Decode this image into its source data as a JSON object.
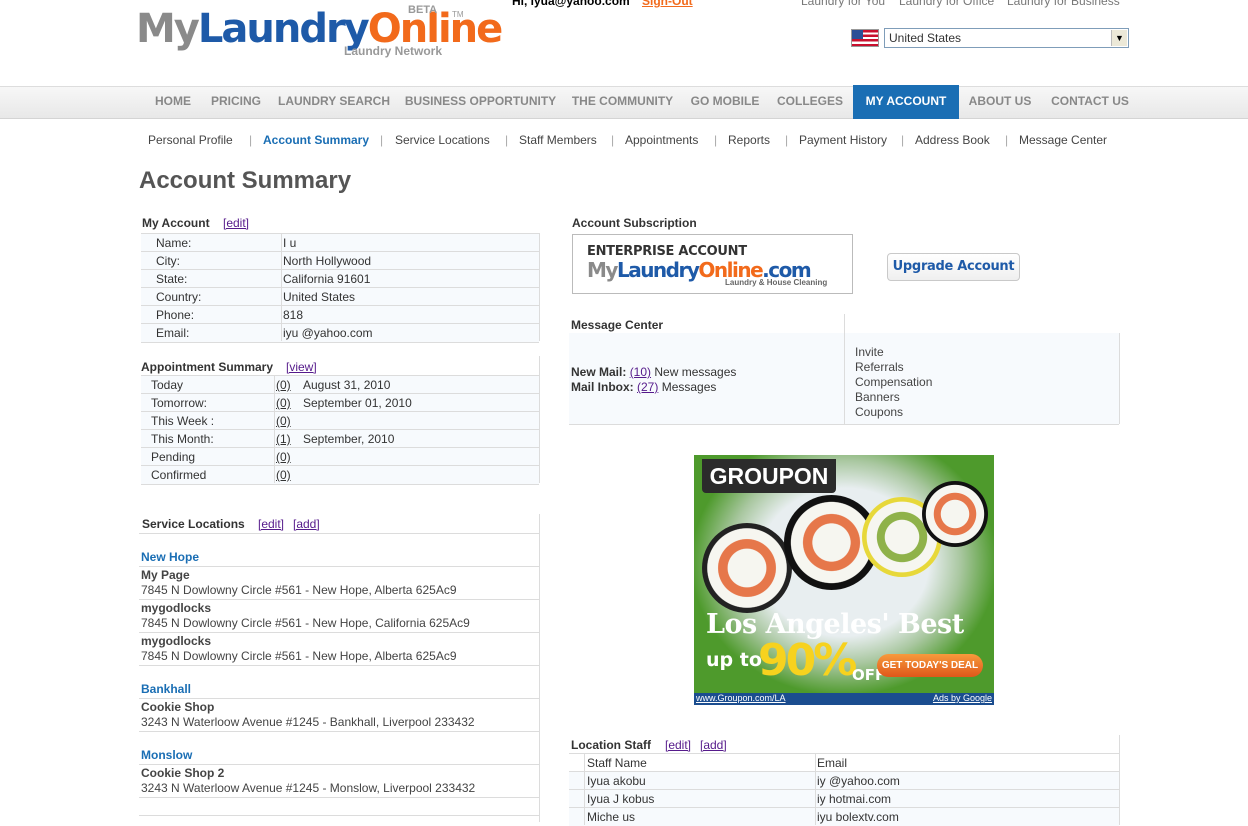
{
  "header": {
    "logo": {
      "my": "My",
      "laundry": "Laundry",
      "online": "Online",
      "beta": "BETA",
      "tm": "TM",
      "tagline": "Laundry Network"
    },
    "greeting": "Hi, iyua@yahoo.com",
    "sign_out": "Sign-Out",
    "top_links": [
      "Laundry for You",
      "Laundry for Office",
      "Laundry for Business"
    ],
    "country_select": {
      "value": "United States",
      "flag": "us-flag-icon"
    }
  },
  "nav": {
    "items": [
      "HOME",
      "PRICING",
      "LAUNDRY SEARCH",
      "BUSINESS OPPORTUNITY",
      "THE COMMUNITY",
      "GO MOBILE",
      "COLLEGES",
      "MY ACCOUNT",
      "ABOUT US",
      "CONTACT US"
    ],
    "active": "MY ACCOUNT",
    "active_color": "#1a6eb4"
  },
  "subnav": {
    "items": [
      "Personal Profile",
      "Account Summary",
      "Service Locations",
      "Staff Members",
      "Appointments",
      "Reports",
      "Payment History",
      "Address Book",
      "Message Center"
    ],
    "active": "Account Summary"
  },
  "page_title": "Account Summary",
  "my_account": {
    "title": "My Account",
    "edit": "[edit]",
    "rows": [
      {
        "label": "Name:",
        "value": "I             u"
      },
      {
        "label": "City:",
        "value": "North Hollywood"
      },
      {
        "label": "State:",
        "value": "California 91601"
      },
      {
        "label": "Country:",
        "value": "United States"
      },
      {
        "label": "Phone:",
        "value": "818"
      },
      {
        "label": "Email:",
        "value": "iyu    @yahoo.com"
      }
    ]
  },
  "appointment_summary": {
    "title": "Appointment Summary",
    "view": "[view]",
    "rows": [
      {
        "label": "Today",
        "count": "(0)",
        "date": "August 31, 2010"
      },
      {
        "label": "Tomorrow:",
        "count": "(0)",
        "date": "September 01, 2010"
      },
      {
        "label": "This Week :",
        "count": "(0)",
        "date": ""
      },
      {
        "label": "This Month:",
        "count": "(1)",
        "date": "September, 2010"
      },
      {
        "label": "Pending",
        "count": "(0)",
        "date": ""
      },
      {
        "label": "Confirmed",
        "count": "(0)",
        "date": ""
      }
    ]
  },
  "service_locations": {
    "title": "Service Locations",
    "edit": "[edit]",
    "add": "[add]",
    "groups": [
      {
        "name": "New Hope",
        "locations": [
          {
            "name": "My Page",
            "address": "7845 N Dowlowny Circle #561 - New Hope, Alberta 625Ac9"
          },
          {
            "name": "mygodlocks",
            "address": "7845 N Dowlowny Circle #561 - New Hope, California 625Ac9"
          },
          {
            "name": "mygodlocks",
            "address": "7845 N Dowlowny Circle #561 - New Hope, Alberta 625Ac9"
          }
        ]
      },
      {
        "name": "Bankhall",
        "locations": [
          {
            "name": "Cookie Shop",
            "address": "3243 N Waterloow Avenue #1245 - Bankhall, Liverpool 233432"
          }
        ]
      },
      {
        "name": "Monslow",
        "locations": [
          {
            "name": "Cookie Shop 2",
            "address": "3243 N Waterloow Avenue #1245 - Monslow, Liverpool 233432"
          }
        ]
      }
    ]
  },
  "subscription": {
    "title": "Account Subscription",
    "badge_title": "ENTERPRISE ACCOUNT",
    "badge_logo": {
      "my": "My",
      "laundry": "Laundry",
      "online": "Online",
      "com": ".com"
    },
    "badge_sub": "Laundry & House Cleaning",
    "upgrade": "Upgrade Account"
  },
  "message_center": {
    "title": "Message Center",
    "new_mail_label": "New Mail:",
    "new_mail_count": "(10)",
    "new_mail_text": "New messages",
    "inbox_label": "Mail Inbox:",
    "inbox_count": "(27)",
    "inbox_text": "Messages",
    "side_links": [
      "Invite",
      "Referrals",
      "Compensation",
      "Banners",
      "Coupons"
    ]
  },
  "ad": {
    "brand": "GROUPON",
    "headline": "Los Angeles' Best",
    "upto": "up to",
    "percent": "90%",
    "off": "OFF",
    "cta": "GET TODAY'S DEAL",
    "footer_left": "www.Groupon.com/LA",
    "footer_right": "Ads by Google"
  },
  "location_staff": {
    "title": "Location Staff",
    "edit": "[edit]",
    "add": "[add]",
    "columns": [
      "Staff Name",
      "Email"
    ],
    "rows": [
      {
        "name": "Iyua    akobu",
        "email": "iy      @yahoo.com"
      },
      {
        "name": "Iyua J    kobus",
        "email": "iy        hotmai.com"
      },
      {
        "name": "Miche       us",
        "email": "iyu       bolextv.com"
      }
    ]
  }
}
